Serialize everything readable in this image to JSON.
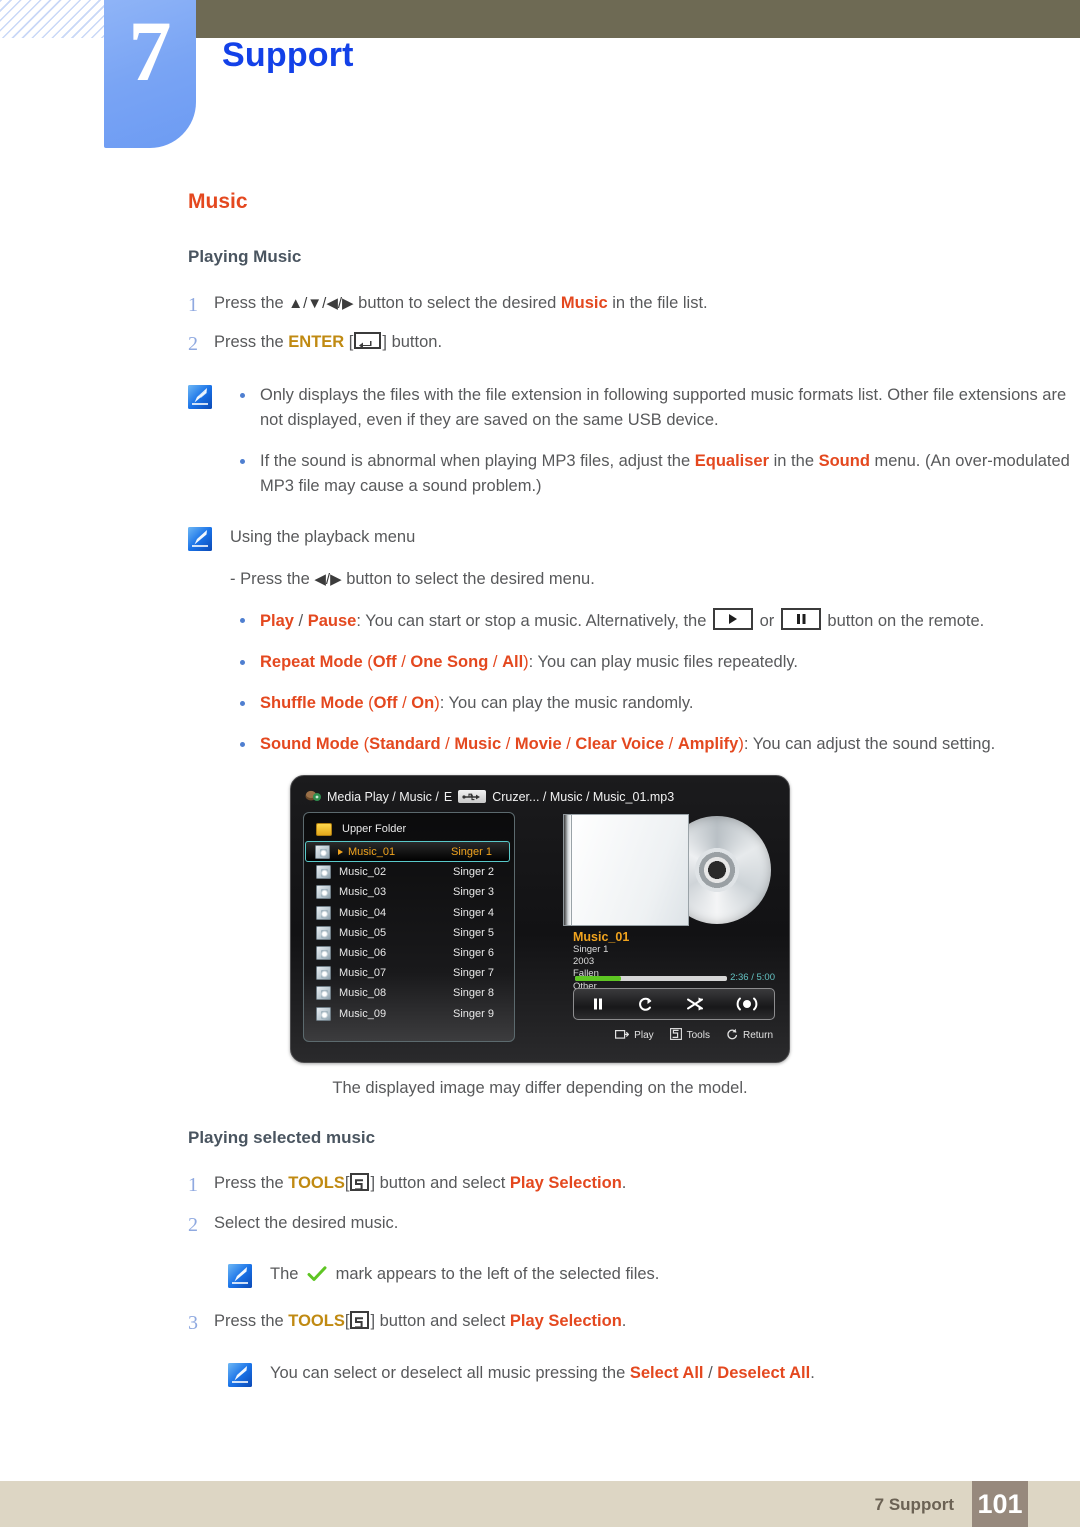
{
  "header": {
    "chapter_number": "7",
    "chapter_title": "Support"
  },
  "section": {
    "title": "Music",
    "sub1": "Playing Music",
    "sub2": "Playing selected music"
  },
  "steps_playing": [
    {
      "num": "1",
      "pre": "Press the ",
      "keys": "▲/▼/◀/▶",
      "mid": " button to select the desired ",
      "hl": "Music",
      "post": " in the file list."
    },
    {
      "num": "2",
      "pre": "Press the ",
      "hl": "ENTER",
      "post": " button."
    }
  ],
  "note_formats": {
    "icon": "note-pen-icon",
    "bullets": [
      "Only displays the files with the file extension in following supported music formats list. Other file extensions are not displayed, even if they are saved on the same USB device.",
      "If the sound is abnormal when playing MP3 files, adjust the Equaliser in the Sound menu. (An over-modulated MP3 file may cause a sound problem.)"
    ],
    "bullet2_parts": {
      "a": "If the sound is abnormal when playing MP3 files, adjust the ",
      "hl1": "Equaliser",
      "b": " in the ",
      "hl2": "Sound",
      "c": " menu. (An over-modulated MP3 file may cause a sound problem.)"
    }
  },
  "playback_menu": {
    "icon": "note-pen-icon",
    "heading": "Using the playback menu",
    "instruction_pre": "- Press the ",
    "instruction_keys": "◀/▶",
    "instruction_post": " button to select the desired menu.",
    "items": [
      {
        "label_a": "Play",
        "sep": " / ",
        "label_b": "Pause",
        "text_a": ": You can start or stop a music. Alternatively, the ",
        "text_or": " or ",
        "text_b": " button on the remote."
      },
      {
        "label": "Repeat Mode",
        "options": "(Off / One Song / All)",
        "opt1": "Off",
        "opt2": "One Song",
        "opt3": "All",
        "text": ": You can play music files repeatedly."
      },
      {
        "label": "Shuffle Mode",
        "opt1": "Off",
        "opt2": "On",
        "text": ": You can play the music randomly."
      },
      {
        "label": "Sound Mode",
        "opt1": "Standard",
        "opt2": "Music",
        "opt3": "Movie",
        "opt4": "Clear Voice",
        "opt5": "Amplify",
        "text": ": You can adjust the sound setting."
      }
    ]
  },
  "tv_screen": {
    "breadcrumb": {
      "part1": "Media Play / Music / ",
      "drive_letter": "E",
      "usb_icon": "usb-icon",
      "part2": "Cruzer... / Music / Music_01.mp3"
    },
    "upper_folder": "Upper Folder",
    "files": [
      {
        "name": "Music_01",
        "singer": "Singer 1",
        "selected": true
      },
      {
        "name": "Music_02",
        "singer": "Singer 2",
        "selected": false
      },
      {
        "name": "Music_03",
        "singer": "Singer 3",
        "selected": false
      },
      {
        "name": "Music_04",
        "singer": "Singer 4",
        "selected": false
      },
      {
        "name": "Music_05",
        "singer": "Singer 5",
        "selected": false
      },
      {
        "name": "Music_06",
        "singer": "Singer 6",
        "selected": false
      },
      {
        "name": "Music_07",
        "singer": "Singer 7",
        "selected": false
      },
      {
        "name": "Music_08",
        "singer": "Singer 8",
        "selected": false
      },
      {
        "name": "Music_09",
        "singer": "Singer 9",
        "selected": false
      }
    ],
    "now_playing": {
      "title": "Music_01",
      "artist": "Singer 1",
      "year": "2003",
      "album": "Fallen",
      "genre": "Other",
      "elapsed": "2:36",
      "separator": " / ",
      "duration": "5:00",
      "timecode": "2:36 / 5:00",
      "progress_percent": 30
    },
    "controls": [
      {
        "name": "pause-icon"
      },
      {
        "name": "repeat-icon"
      },
      {
        "name": "shuffle-icon"
      },
      {
        "name": "sound-mode-icon"
      }
    ],
    "footer_keys": [
      {
        "icon": "enter-key-icon",
        "label": "Play"
      },
      {
        "icon": "tools-key-icon",
        "label": "Tools"
      },
      {
        "icon": "return-key-icon",
        "label": "Return"
      }
    ]
  },
  "caption": "The displayed image may differ depending on the model.",
  "steps_selected": [
    {
      "num": "1",
      "pre": "Press the ",
      "key": "TOOLS",
      "mid": " button and select ",
      "hl": "Play Selection",
      "post": "."
    },
    {
      "num": "2",
      "text": "Select the desired music."
    },
    {
      "num": "3",
      "pre": "Press the ",
      "key": "TOOLS",
      "mid": " button and select ",
      "hl": "Play Selection",
      "post": "."
    }
  ],
  "note_check": {
    "icon": "note-pen-icon",
    "pre": "The ",
    "mark": "check-icon",
    "post": " mark appears to the left of the selected files."
  },
  "note_selectall": {
    "icon": "note-pen-icon",
    "pre": "You can select or deselect all music pressing the ",
    "hl1": "Select All",
    "sep": " / ",
    "hl2": "Deselect All",
    "post": "."
  },
  "footer": {
    "text": "7 Support",
    "page": "101"
  },
  "colors": {
    "accent_orange": "#e4481f",
    "accent_yellow": "#c08a12",
    "chapter_blue": "#1341e8",
    "topbar": "#6e6a54",
    "footer_bar": "#ddd6c4",
    "page_box": "#97897d",
    "bullet_blue": "#4f7fd0",
    "check_green": "#5ec523"
  }
}
